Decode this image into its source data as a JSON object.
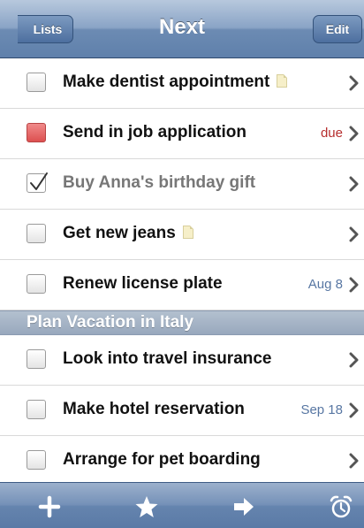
{
  "navbar": {
    "title": "Next",
    "back_label": "Lists",
    "edit_label": "Edit"
  },
  "colors": {
    "navbar": "#7d9abf",
    "overdue_checkbox": "#e06060",
    "due_text": "#b62e2e",
    "date_text": "#5877a3",
    "section_header": "#a5b4c8"
  },
  "tasks": [
    {
      "label": "Make dentist appointment",
      "note": true,
      "meta": "",
      "state": "open"
    },
    {
      "label": "Send in job application",
      "note": false,
      "meta": "due",
      "state": "overdue"
    },
    {
      "label": "Buy Anna's birthday gift",
      "note": false,
      "meta": "",
      "state": "done"
    },
    {
      "label": "Get new jeans",
      "note": true,
      "meta": "",
      "state": "open"
    },
    {
      "label": "Renew license plate",
      "note": false,
      "meta": "Aug 8",
      "state": "open"
    }
  ],
  "section": {
    "title": "Plan Vacation in Italy",
    "tasks": [
      {
        "label": "Look into travel insurance",
        "note": false,
        "meta": "",
        "state": "open"
      },
      {
        "label": "Make hotel reservation",
        "note": false,
        "meta": "Sep 18",
        "state": "open"
      },
      {
        "label": "Arrange for pet boarding",
        "note": false,
        "meta": "",
        "state": "open"
      }
    ]
  },
  "toolbar": {
    "icons": [
      "plus-icon",
      "star-icon",
      "arrow-right-icon",
      "alarm-clock-icon"
    ]
  }
}
